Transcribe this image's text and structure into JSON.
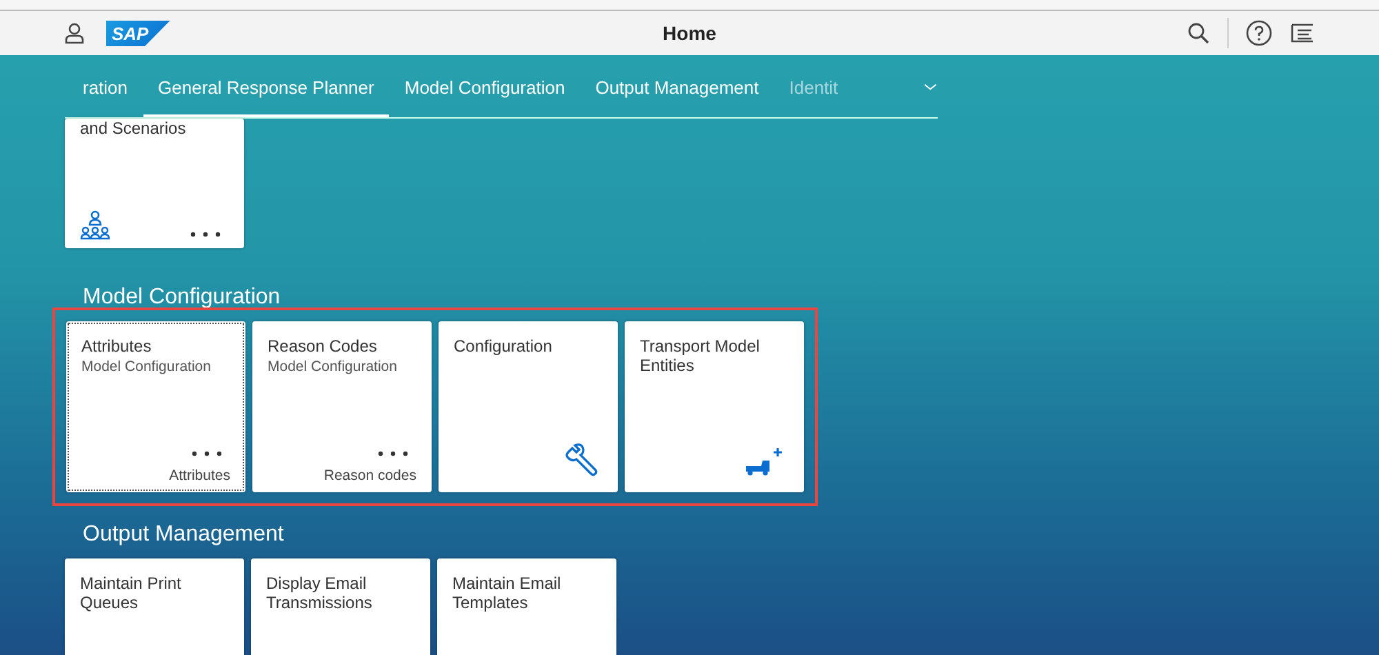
{
  "shell": {
    "title": "Home",
    "logo": "SAP"
  },
  "tabs": [
    {
      "label": "ration",
      "selected": false,
      "faded": false
    },
    {
      "label": "General Response Planner",
      "selected": true,
      "faded": false
    },
    {
      "label": "Model Configuration",
      "selected": false,
      "faded": false
    },
    {
      "label": "Output Management",
      "selected": false,
      "faded": false
    },
    {
      "label": "Identit",
      "selected": false,
      "faded": true
    }
  ],
  "sections": [
    {
      "highlighted": false,
      "tiles": [
        {
          "kind": "people",
          "title": "and Scenarios",
          "more": true,
          "focused": false
        }
      ]
    },
    {
      "title": "Model Configuration",
      "highlighted": true,
      "tiles": [
        {
          "kind": "plain",
          "title": "Attributes",
          "subtitle": "Model Configuration",
          "footer": "Attributes",
          "more": true,
          "focused": true
        },
        {
          "kind": "plain",
          "title": "Reason Codes",
          "subtitle": "Model Configuration",
          "footer": "Reason codes",
          "more": true,
          "focused": false
        },
        {
          "kind": "wrench",
          "title": "Configuration",
          "more": false,
          "focused": false
        },
        {
          "kind": "truck",
          "title": "Transport Model Entities",
          "more": false,
          "focused": false
        }
      ]
    },
    {
      "title": "Output Management",
      "highlighted": false,
      "tiles": [
        {
          "kind": "plain",
          "title": "Maintain Print Queues",
          "more": false,
          "focused": false
        },
        {
          "kind": "plain",
          "title": "Display Email Transmissions",
          "more": false,
          "focused": false
        },
        {
          "kind": "plain",
          "title": "Maintain Email Templates",
          "more": false,
          "focused": false
        }
      ]
    }
  ]
}
